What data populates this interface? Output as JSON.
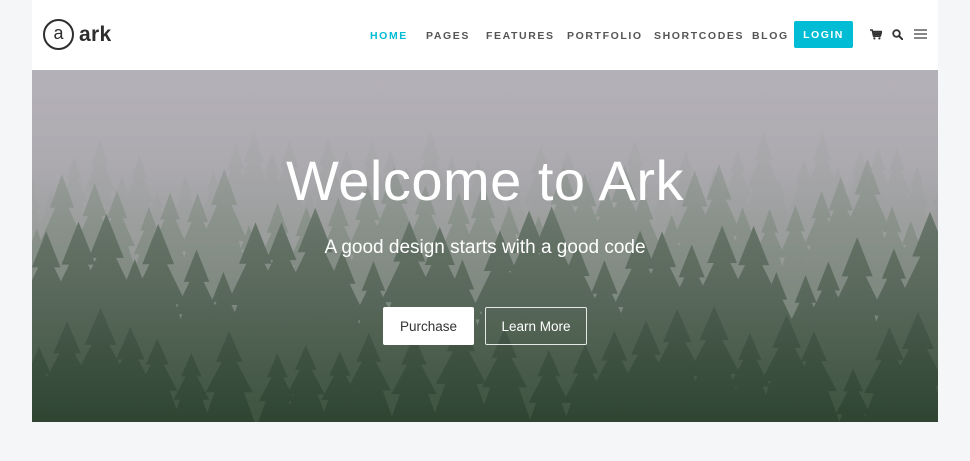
{
  "header": {
    "logo_mark": "a",
    "logo_text": "ark",
    "nav": [
      "HOME",
      "PAGES",
      "FEATURES",
      "PORTFOLIO",
      "SHORTCODES",
      "BLOG"
    ],
    "login": "LOGIN",
    "icons": [
      "cart-icon",
      "search-icon",
      "menu-icon"
    ]
  },
  "hero": {
    "title": "Welcome to Ark",
    "subtitle": "A good design starts with a good code",
    "primary_button": "Purchase",
    "secondary_button": "Learn More"
  },
  "colors": {
    "accent": "#00bcd4",
    "nav_text": "#555555"
  }
}
